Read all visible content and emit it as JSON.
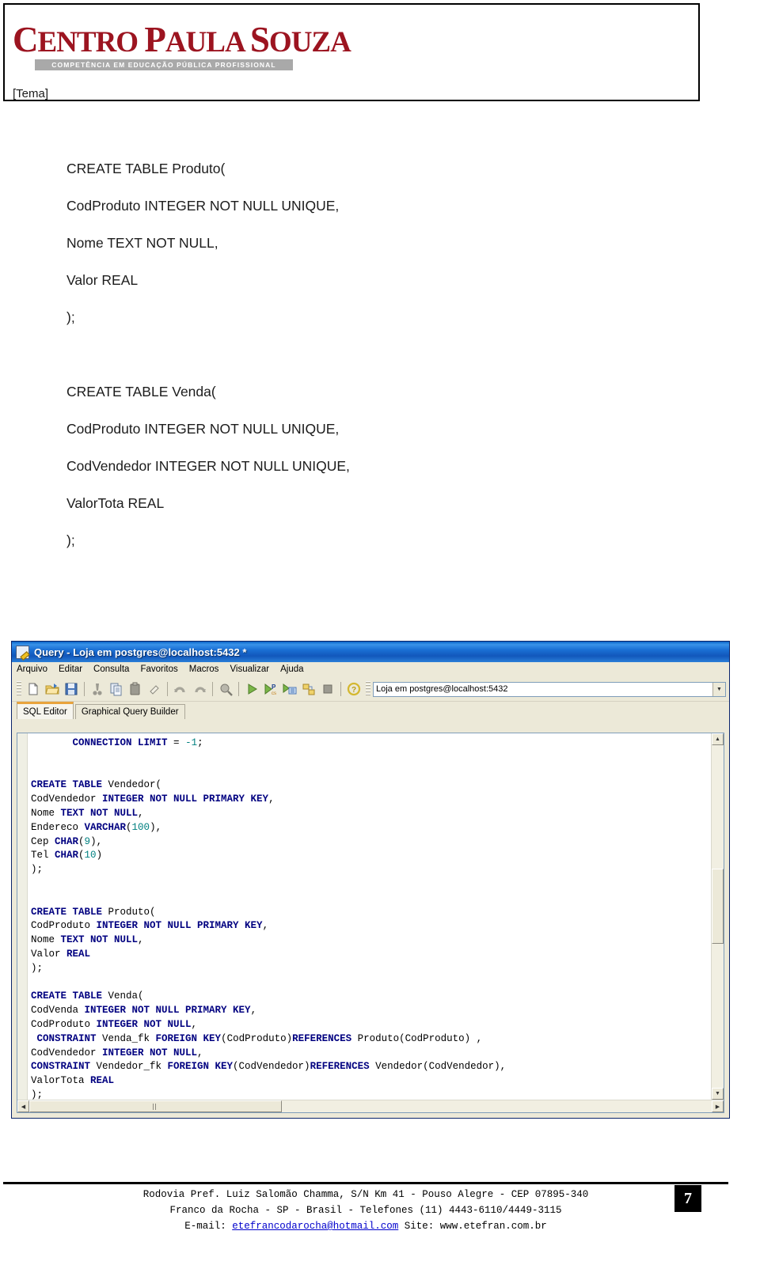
{
  "header": {
    "logo_line": "CENTRO PAULA SOUZA",
    "logo_c": "C",
    "logo_entro": "ENTRO ",
    "logo_p": "P",
    "logo_aula": "AULA ",
    "logo_s": "S",
    "logo_ouza": "OUZA",
    "tagline": "COMPETÊNCIA EM EDUCAÇÃO PÚBLICA PROFISSIONAL",
    "theme": "[Tema]",
    "brand_color": "#9c1420",
    "tagline_bg": "#a9a9a9"
  },
  "document": {
    "block1": [
      "CREATE TABLE Produto(",
      "CodProduto INTEGER NOT NULL UNIQUE,",
      "Nome TEXT NOT NULL,",
      "Valor REAL",
      ");"
    ],
    "block2": [
      "CREATE TABLE Venda(",
      "CodProduto INTEGER NOT NULL UNIQUE,",
      "CodVendedor INTEGER NOT NULL UNIQUE,",
      "ValorTota REAL",
      ");"
    ]
  },
  "window": {
    "title": "Query - Loja em postgres@localhost:5432 *",
    "title_icon": "query-document-icon",
    "menus": [
      "Arquivo",
      "Editar",
      "Consulta",
      "Favoritos",
      "Macros",
      "Visualizar",
      "Ajuda"
    ],
    "toolbar_icons": [
      "new-file-icon",
      "open-folder-icon",
      "save-icon",
      "cut-icon",
      "copy-icon",
      "paste-icon",
      "clear-icon",
      "undo-icon",
      "redo-icon",
      "find-icon",
      "execute-query-icon",
      "explain-query-icon",
      "execute-to-file-icon",
      "query-builder-icon",
      "stop-icon",
      "help-icon"
    ],
    "connection": {
      "value": "Loja em postgres@localhost:5432",
      "dropdown_icon": "chevron-down-icon"
    },
    "tabs": [
      {
        "label": "SQL Editor",
        "active": true
      },
      {
        "label": "Graphical Query Builder",
        "active": false
      }
    ],
    "editor": {
      "lines": [
        {
          "indent": 7,
          "tokens": [
            {
              "t": "CONNECTION LIMIT",
              "k": "kw"
            },
            {
              "t": " = "
            },
            {
              "t": "-1",
              "k": "num"
            },
            {
              "t": ";"
            }
          ]
        },
        {
          "tokens": []
        },
        {
          "tokens": []
        },
        {
          "tokens": [
            {
              "t": "CREATE TABLE ",
              "k": "kw"
            },
            {
              "t": "Vendedor("
            }
          ]
        },
        {
          "tokens": [
            {
              "t": "CodVendedor "
            },
            {
              "t": "INTEGER NOT NULL PRIMARY KEY",
              "k": "kw"
            },
            {
              "t": ","
            }
          ]
        },
        {
          "tokens": [
            {
              "t": "Nome "
            },
            {
              "t": "TEXT NOT NULL",
              "k": "kw"
            },
            {
              "t": ","
            }
          ]
        },
        {
          "tokens": [
            {
              "t": "Endereco "
            },
            {
              "t": "VARCHAR",
              "k": "kw"
            },
            {
              "t": "("
            },
            {
              "t": "100",
              "k": "num"
            },
            {
              "t": "),"
            }
          ]
        },
        {
          "tokens": [
            {
              "t": "Cep "
            },
            {
              "t": "CHAR",
              "k": "kw"
            },
            {
              "t": "("
            },
            {
              "t": "9",
              "k": "num"
            },
            {
              "t": "),"
            }
          ]
        },
        {
          "tokens": [
            {
              "t": "Tel "
            },
            {
              "t": "CHAR",
              "k": "kw"
            },
            {
              "t": "("
            },
            {
              "t": "10",
              "k": "num"
            },
            {
              "t": ")"
            }
          ]
        },
        {
          "tokens": [
            {
              "t": ");"
            }
          ]
        },
        {
          "tokens": []
        },
        {
          "tokens": []
        },
        {
          "tokens": [
            {
              "t": "CREATE TABLE ",
              "k": "kw"
            },
            {
              "t": "Produto("
            }
          ]
        },
        {
          "tokens": [
            {
              "t": "CodProduto "
            },
            {
              "t": "INTEGER NOT NULL PRIMARY KEY",
              "k": "kw"
            },
            {
              "t": ","
            }
          ]
        },
        {
          "tokens": [
            {
              "t": "Nome "
            },
            {
              "t": "TEXT NOT NULL",
              "k": "kw"
            },
            {
              "t": ","
            }
          ]
        },
        {
          "tokens": [
            {
              "t": "Valor "
            },
            {
              "t": "REAL",
              "k": "kw"
            }
          ]
        },
        {
          "tokens": [
            {
              "t": ");"
            }
          ]
        },
        {
          "tokens": []
        },
        {
          "tokens": [
            {
              "t": "CREATE TABLE ",
              "k": "kw"
            },
            {
              "t": "Venda("
            }
          ]
        },
        {
          "tokens": [
            {
              "t": "CodVenda "
            },
            {
              "t": "INTEGER NOT NULL PRIMARY KEY",
              "k": "kw"
            },
            {
              "t": ","
            }
          ]
        },
        {
          "tokens": [
            {
              "t": "CodProduto "
            },
            {
              "t": "INTEGER NOT NULL",
              "k": "kw"
            },
            {
              "t": ","
            }
          ]
        },
        {
          "indent": 1,
          "tokens": [
            {
              "t": "CONSTRAINT ",
              "k": "kw"
            },
            {
              "t": "Venda_fk "
            },
            {
              "t": "FOREIGN KEY",
              "k": "kw"
            },
            {
              "t": "(CodProduto)"
            },
            {
              "t": "REFERENCES",
              "k": "kw"
            },
            {
              "t": " Produto(CodProduto) ,"
            }
          ]
        },
        {
          "tokens": [
            {
              "t": "CodVendedor "
            },
            {
              "t": "INTEGER NOT NULL",
              "k": "kw"
            },
            {
              "t": ","
            }
          ]
        },
        {
          "tokens": [
            {
              "t": "CONSTRAINT ",
              "k": "kw"
            },
            {
              "t": "Vendedor_fk "
            },
            {
              "t": "FOREIGN KEY",
              "k": "kw"
            },
            {
              "t": "(CodVendedor)"
            },
            {
              "t": "REFERENCES",
              "k": "kw"
            },
            {
              "t": " Vendedor(CodVendedor),"
            }
          ]
        },
        {
          "tokens": [
            {
              "t": "ValorTota "
            },
            {
              "t": "REAL",
              "k": "kw"
            }
          ]
        },
        {
          "tokens": [
            {
              "t": ");"
            }
          ]
        }
      ],
      "vscroll_up_icon": "chevron-up-icon",
      "vscroll_down_icon": "chevron-down-icon",
      "hscroll_left_icon": "chevron-left-icon",
      "hscroll_right_icon": "chevron-right-icon"
    }
  },
  "footer": {
    "line1": "Rodovia Pref. Luiz Salomão Chamma, S/N Km 41 - Pouso Alegre - CEP 07895-340",
    "line2": "Franco da Rocha - SP - Brasil - Telefones (11) 4443-6110/4449-3115",
    "line3_prefix": "E-mail: ",
    "email": "etefrancodarocha@hotmail.com",
    "line3_middle": " Site: ",
    "site": "www.etefran.com.br",
    "page_number": "7"
  }
}
